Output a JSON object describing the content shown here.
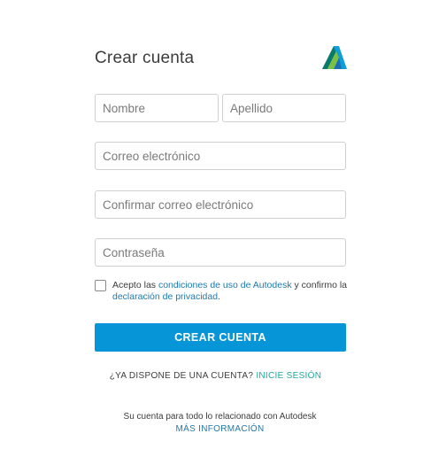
{
  "header": {
    "title": "Crear cuenta",
    "logo_icon": "autodesk-logo-icon"
  },
  "form": {
    "first_name_placeholder": "Nombre",
    "last_name_placeholder": "Apellido",
    "email_placeholder": "Correo electrónico",
    "confirm_email_placeholder": "Confirmar correo electrónico",
    "password_placeholder": "Contraseña"
  },
  "terms": {
    "checked": false,
    "prefix": "Acepto las ",
    "terms_link": "condiciones de uso de Autodesk",
    "middle": " y confirmo la ",
    "privacy_link": "declaración de privacidad",
    "suffix": "."
  },
  "actions": {
    "create_account_label": "CREAR CUENTA",
    "have_account_text": "¿YA DISPONE DE UNA CUENTA? ",
    "sign_in_label": "INICIE SESIÓN"
  },
  "footer": {
    "account_text": "Su cuenta para todo lo relacionado con Autodesk",
    "more_info_label": "MÁS INFORMACIÓN"
  },
  "colors": {
    "primary_button": "#0696d7",
    "link": "#1f79ad",
    "signin_link": "#1fa8a0",
    "input_border": "#cfcfcf"
  }
}
